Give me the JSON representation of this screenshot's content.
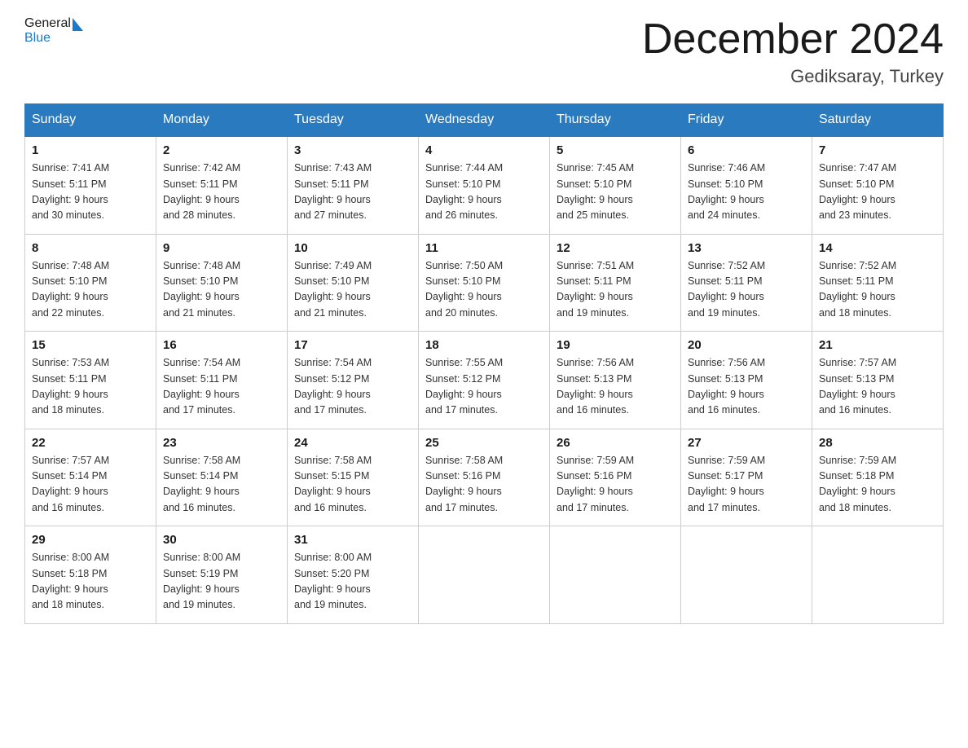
{
  "header": {
    "title": "December 2024",
    "location": "Gediksaray, Turkey",
    "logo_general": "General",
    "logo_blue": "Blue"
  },
  "days_of_week": [
    "Sunday",
    "Monday",
    "Tuesday",
    "Wednesday",
    "Thursday",
    "Friday",
    "Saturday"
  ],
  "weeks": [
    [
      {
        "day": "1",
        "sunrise": "7:41 AM",
        "sunset": "5:11 PM",
        "daylight": "9 hours and 30 minutes."
      },
      {
        "day": "2",
        "sunrise": "7:42 AM",
        "sunset": "5:11 PM",
        "daylight": "9 hours and 28 minutes."
      },
      {
        "day": "3",
        "sunrise": "7:43 AM",
        "sunset": "5:11 PM",
        "daylight": "9 hours and 27 minutes."
      },
      {
        "day": "4",
        "sunrise": "7:44 AM",
        "sunset": "5:10 PM",
        "daylight": "9 hours and 26 minutes."
      },
      {
        "day": "5",
        "sunrise": "7:45 AM",
        "sunset": "5:10 PM",
        "daylight": "9 hours and 25 minutes."
      },
      {
        "day": "6",
        "sunrise": "7:46 AM",
        "sunset": "5:10 PM",
        "daylight": "9 hours and 24 minutes."
      },
      {
        "day": "7",
        "sunrise": "7:47 AM",
        "sunset": "5:10 PM",
        "daylight": "9 hours and 23 minutes."
      }
    ],
    [
      {
        "day": "8",
        "sunrise": "7:48 AM",
        "sunset": "5:10 PM",
        "daylight": "9 hours and 22 minutes."
      },
      {
        "day": "9",
        "sunrise": "7:48 AM",
        "sunset": "5:10 PM",
        "daylight": "9 hours and 21 minutes."
      },
      {
        "day": "10",
        "sunrise": "7:49 AM",
        "sunset": "5:10 PM",
        "daylight": "9 hours and 21 minutes."
      },
      {
        "day": "11",
        "sunrise": "7:50 AM",
        "sunset": "5:10 PM",
        "daylight": "9 hours and 20 minutes."
      },
      {
        "day": "12",
        "sunrise": "7:51 AM",
        "sunset": "5:11 PM",
        "daylight": "9 hours and 19 minutes."
      },
      {
        "day": "13",
        "sunrise": "7:52 AM",
        "sunset": "5:11 PM",
        "daylight": "9 hours and 19 minutes."
      },
      {
        "day": "14",
        "sunrise": "7:52 AM",
        "sunset": "5:11 PM",
        "daylight": "9 hours and 18 minutes."
      }
    ],
    [
      {
        "day": "15",
        "sunrise": "7:53 AM",
        "sunset": "5:11 PM",
        "daylight": "9 hours and 18 minutes."
      },
      {
        "day": "16",
        "sunrise": "7:54 AM",
        "sunset": "5:11 PM",
        "daylight": "9 hours and 17 minutes."
      },
      {
        "day": "17",
        "sunrise": "7:54 AM",
        "sunset": "5:12 PM",
        "daylight": "9 hours and 17 minutes."
      },
      {
        "day": "18",
        "sunrise": "7:55 AM",
        "sunset": "5:12 PM",
        "daylight": "9 hours and 17 minutes."
      },
      {
        "day": "19",
        "sunrise": "7:56 AM",
        "sunset": "5:13 PM",
        "daylight": "9 hours and 16 minutes."
      },
      {
        "day": "20",
        "sunrise": "7:56 AM",
        "sunset": "5:13 PM",
        "daylight": "9 hours and 16 minutes."
      },
      {
        "day": "21",
        "sunrise": "7:57 AM",
        "sunset": "5:13 PM",
        "daylight": "9 hours and 16 minutes."
      }
    ],
    [
      {
        "day": "22",
        "sunrise": "7:57 AM",
        "sunset": "5:14 PM",
        "daylight": "9 hours and 16 minutes."
      },
      {
        "day": "23",
        "sunrise": "7:58 AM",
        "sunset": "5:14 PM",
        "daylight": "9 hours and 16 minutes."
      },
      {
        "day": "24",
        "sunrise": "7:58 AM",
        "sunset": "5:15 PM",
        "daylight": "9 hours and 16 minutes."
      },
      {
        "day": "25",
        "sunrise": "7:58 AM",
        "sunset": "5:16 PM",
        "daylight": "9 hours and 17 minutes."
      },
      {
        "day": "26",
        "sunrise": "7:59 AM",
        "sunset": "5:16 PM",
        "daylight": "9 hours and 17 minutes."
      },
      {
        "day": "27",
        "sunrise": "7:59 AM",
        "sunset": "5:17 PM",
        "daylight": "9 hours and 17 minutes."
      },
      {
        "day": "28",
        "sunrise": "7:59 AM",
        "sunset": "5:18 PM",
        "daylight": "9 hours and 18 minutes."
      }
    ],
    [
      {
        "day": "29",
        "sunrise": "8:00 AM",
        "sunset": "5:18 PM",
        "daylight": "9 hours and 18 minutes."
      },
      {
        "day": "30",
        "sunrise": "8:00 AM",
        "sunset": "5:19 PM",
        "daylight": "9 hours and 19 minutes."
      },
      {
        "day": "31",
        "sunrise": "8:00 AM",
        "sunset": "5:20 PM",
        "daylight": "9 hours and 19 minutes."
      },
      null,
      null,
      null,
      null
    ]
  ],
  "labels": {
    "sunrise": "Sunrise:",
    "sunset": "Sunset:",
    "daylight": "Daylight:"
  }
}
